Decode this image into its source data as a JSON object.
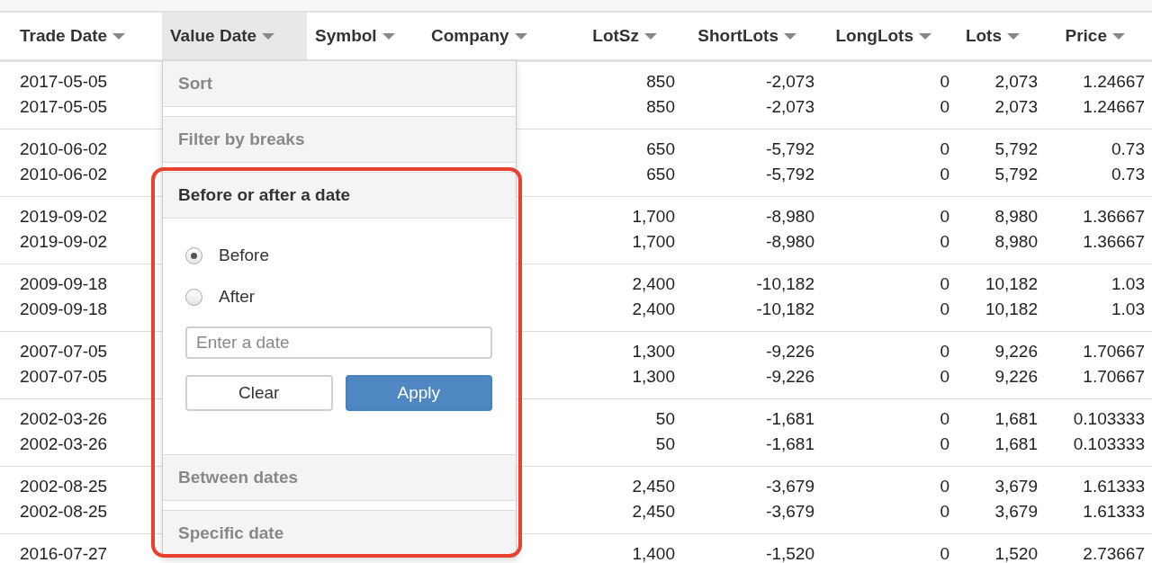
{
  "table": {
    "columns": [
      {
        "label": "Trade Date",
        "active": false
      },
      {
        "label": "Value Date",
        "active": true
      },
      {
        "label": "Symbol",
        "active": false
      },
      {
        "label": "Company",
        "active": false
      },
      {
        "label": "LotSz",
        "active": false
      },
      {
        "label": "ShortLots",
        "active": false
      },
      {
        "label": "LongLots",
        "active": false
      },
      {
        "label": "Lots",
        "active": false
      },
      {
        "label": "Price",
        "active": false
      }
    ],
    "groups": [
      {
        "rows": [
          {
            "trade_date": "2017-05-05",
            "lot_sz": "850",
            "short_lots": "-2,073",
            "long_lots": "0",
            "lots": "2,073",
            "price": "1.24667"
          },
          {
            "trade_date": "2017-05-05",
            "lot_sz": "850",
            "short_lots": "-2,073",
            "long_lots": "0",
            "lots": "2,073",
            "price": "1.24667"
          }
        ]
      },
      {
        "rows": [
          {
            "trade_date": "2010-06-02",
            "lot_sz": "650",
            "short_lots": "-5,792",
            "long_lots": "0",
            "lots": "5,792",
            "price": "0.73"
          },
          {
            "trade_date": "2010-06-02",
            "lot_sz": "650",
            "short_lots": "-5,792",
            "long_lots": "0",
            "lots": "5,792",
            "price": "0.73"
          }
        ]
      },
      {
        "rows": [
          {
            "trade_date": "2019-09-02",
            "lot_sz": "1,700",
            "short_lots": "-8,980",
            "long_lots": "0",
            "lots": "8,980",
            "price": "1.36667"
          },
          {
            "trade_date": "2019-09-02",
            "lot_sz": "1,700",
            "short_lots": "-8,980",
            "long_lots": "0",
            "lots": "8,980",
            "price": "1.36667"
          }
        ]
      },
      {
        "rows": [
          {
            "trade_date": "2009-09-18",
            "lot_sz": "2,400",
            "short_lots": "-10,182",
            "long_lots": "0",
            "lots": "10,182",
            "price": "1.03"
          },
          {
            "trade_date": "2009-09-18",
            "lot_sz": "2,400",
            "short_lots": "-10,182",
            "long_lots": "0",
            "lots": "10,182",
            "price": "1.03"
          }
        ]
      },
      {
        "rows": [
          {
            "trade_date": "2007-07-05",
            "lot_sz": "1,300",
            "short_lots": "-9,226",
            "long_lots": "0",
            "lots": "9,226",
            "price": "1.70667"
          },
          {
            "trade_date": "2007-07-05",
            "lot_sz": "1,300",
            "short_lots": "-9,226",
            "long_lots": "0",
            "lots": "9,226",
            "price": "1.70667"
          }
        ]
      },
      {
        "rows": [
          {
            "trade_date": "2002-03-26",
            "lot_sz": "50",
            "short_lots": "-1,681",
            "long_lots": "0",
            "lots": "1,681",
            "price": "0.103333"
          },
          {
            "trade_date": "2002-03-26",
            "lot_sz": "50",
            "short_lots": "-1,681",
            "long_lots": "0",
            "lots": "1,681",
            "price": "0.103333"
          }
        ]
      },
      {
        "rows": [
          {
            "trade_date": "2002-08-25",
            "lot_sz": "2,450",
            "short_lots": "-3,679",
            "long_lots": "0",
            "lots": "3,679",
            "price": "1.61333"
          },
          {
            "trade_date": "2002-08-25",
            "lot_sz": "2,450",
            "short_lots": "-3,679",
            "long_lots": "0",
            "lots": "3,679",
            "price": "1.61333"
          }
        ]
      },
      {
        "rows": [
          {
            "trade_date": "2016-07-27",
            "lot_sz": "1,400",
            "short_lots": "-1,520",
            "long_lots": "0",
            "lots": "1,520",
            "price": "2.73667"
          }
        ]
      }
    ]
  },
  "filter_menu": {
    "sections": [
      {
        "title": "Sort",
        "expanded": false
      },
      {
        "title": "Filter by breaks",
        "expanded": false
      },
      {
        "title": "Before or after a date",
        "expanded": true,
        "highlighted": true,
        "options": [
          {
            "label": "Before",
            "selected": true
          },
          {
            "label": "After",
            "selected": false
          }
        ],
        "date_field": {
          "placeholder": "Enter a date"
        },
        "buttons": [
          {
            "label": "Clear",
            "kind": "default"
          },
          {
            "label": "Apply",
            "kind": "primary"
          }
        ]
      },
      {
        "title": "Between dates",
        "expanded": false
      },
      {
        "title": "Specific date",
        "expanded": false
      }
    ]
  }
}
